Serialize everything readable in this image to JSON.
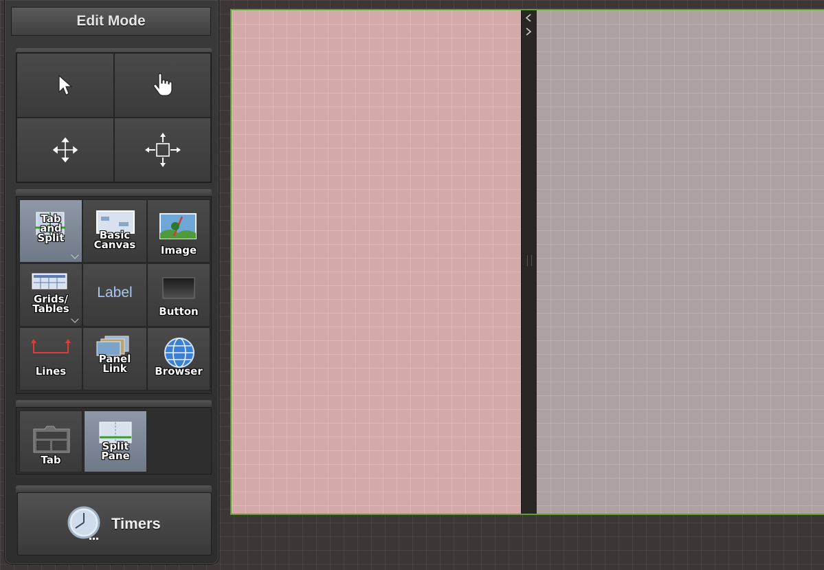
{
  "toolbox": {
    "mode_title": "Edit Mode",
    "cursor_tools": [
      {
        "name": "pointer-icon"
      },
      {
        "name": "hand-icon"
      },
      {
        "name": "move-icon"
      },
      {
        "name": "resize-move-icon"
      }
    ],
    "components": [
      {
        "label_lines": [
          "Tab",
          "and",
          "Split"
        ],
        "selected": true,
        "dropdown": true
      },
      {
        "label_lines": [
          "Basic",
          "Canvas"
        ]
      },
      {
        "label_lines": [
          "Image"
        ]
      },
      {
        "label_lines": [
          "Grids/",
          "Tables"
        ],
        "dropdown": true
      },
      {
        "label": "Label"
      },
      {
        "label_lines": [
          "Button"
        ]
      },
      {
        "label_lines": [
          "Lines"
        ]
      },
      {
        "label_lines": [
          "Panel",
          "Link"
        ]
      },
      {
        "label_lines": [
          "Browser"
        ]
      }
    ],
    "subcomponents": [
      {
        "label_lines": [
          "Tab"
        ]
      },
      {
        "label_lines": [
          "Split",
          "Pane"
        ],
        "selected": true
      }
    ],
    "timers_label": "Timers"
  },
  "colors": {
    "accent_green": "#5fa22d",
    "left_pane": "#d3a9aa",
    "right_pane": "#aea1a2",
    "selected_tool": "#7e8896"
  }
}
